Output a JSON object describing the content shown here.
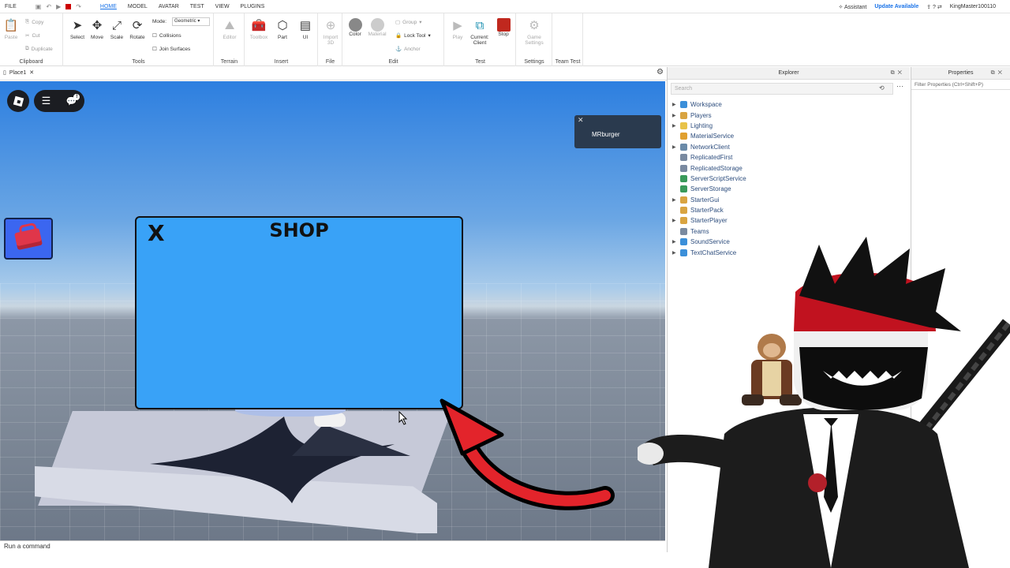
{
  "menubar": {
    "file": "FILE",
    "tabs": [
      "HOME",
      "MODEL",
      "AVATAR",
      "TEST",
      "VIEW",
      "PLUGINS"
    ],
    "active_tab": "HOME",
    "assistant": "Assistant",
    "update": "Update Available",
    "username": "KingMaster100110"
  },
  "ribbon": {
    "clipboard": {
      "paste": "Paste",
      "copy": "Copy",
      "cut": "Cut",
      "duplicate": "Duplicate",
      "label": "Clipboard"
    },
    "tools": {
      "select": "Select",
      "move": "Move",
      "scale": "Scale",
      "rotate": "Rotate",
      "mode": "Mode:",
      "mode_value": "Geometric",
      "collisions": "Collisions",
      "join": "Join Surfaces",
      "label": "Tools"
    },
    "terrain": {
      "editor": "Editor",
      "label": "Terrain"
    },
    "insert": {
      "toolbox": "Toolbox",
      "part": "Part",
      "ui": "UI",
      "label": "Insert"
    },
    "file": {
      "import": "Import",
      "import_sub": "3D",
      "label": "File"
    },
    "edit": {
      "color": "Color",
      "material": "Material",
      "group": "Group",
      "lock": "Lock Tool",
      "anchor": "Anchor",
      "label": "Edit"
    },
    "test": {
      "play": "Play",
      "current": "Current:",
      "client": "Client",
      "stop": "Stop",
      "label": "Test"
    },
    "settings": {
      "game": "Game",
      "game_sub": "Settings",
      "label": "Settings"
    },
    "teamtest": {
      "label": "Team Test"
    }
  },
  "doc_tab": {
    "name": "Place1"
  },
  "game": {
    "player_name": "MRburger",
    "shop_title": "SHOP",
    "shop_close": "X"
  },
  "command_bar": {
    "placeholder": "Run a command"
  },
  "explorer": {
    "title": "Explorer",
    "search_placeholder": "Search",
    "items": [
      {
        "name": "Workspace",
        "expand": true,
        "color": "#3b8fd9"
      },
      {
        "name": "Players",
        "expand": true,
        "color": "#d9a441"
      },
      {
        "name": "Lighting",
        "expand": true,
        "color": "#e8c34a"
      },
      {
        "name": "MaterialService",
        "expand": false,
        "color": "#e0a030"
      },
      {
        "name": "NetworkClient",
        "expand": true,
        "color": "#6a8aa8"
      },
      {
        "name": "ReplicatedFirst",
        "expand": false,
        "color": "#7a8aa0"
      },
      {
        "name": "ReplicatedStorage",
        "expand": false,
        "color": "#7a8aa0"
      },
      {
        "name": "ServerScriptService",
        "expand": false,
        "color": "#3a9a5a"
      },
      {
        "name": "ServerStorage",
        "expand": false,
        "color": "#3a9a5a"
      },
      {
        "name": "StarterGui",
        "expand": true,
        "color": "#d9a441"
      },
      {
        "name": "StarterPack",
        "expand": false,
        "color": "#d9a441"
      },
      {
        "name": "StarterPlayer",
        "expand": true,
        "color": "#d9a441"
      },
      {
        "name": "Teams",
        "expand": false,
        "color": "#7a8aa0"
      },
      {
        "name": "SoundService",
        "expand": true,
        "color": "#3b8fd9"
      },
      {
        "name": "TextChatService",
        "expand": true,
        "color": "#3b8fd9"
      }
    ]
  },
  "properties": {
    "title": "Properties",
    "filter": "Filter Properties (Ctrl+Shift+P)"
  }
}
